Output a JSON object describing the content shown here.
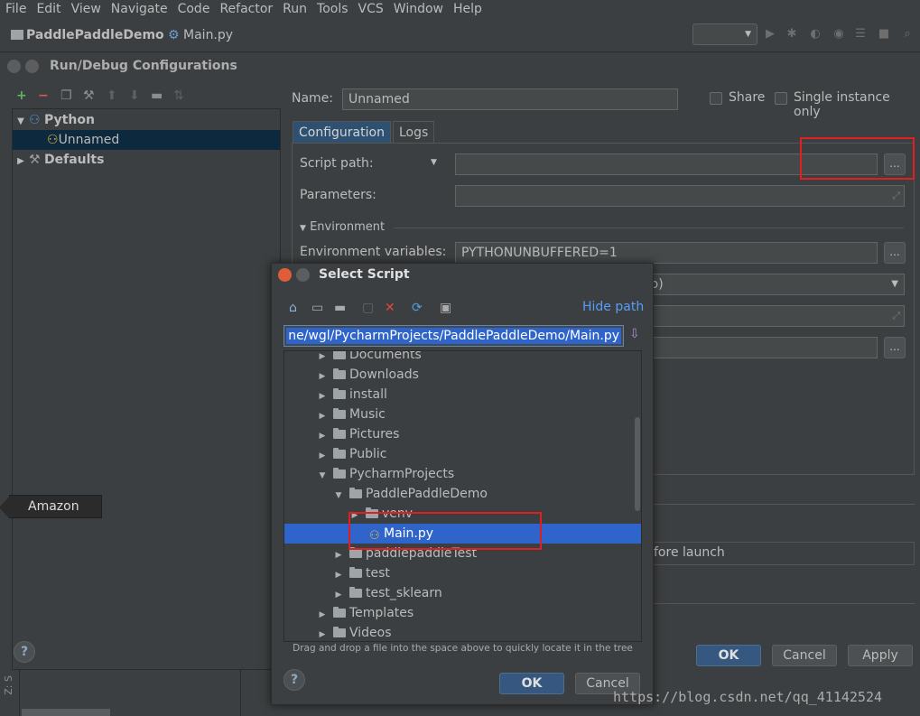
{
  "menu": [
    "File",
    "Edit",
    "View",
    "Navigate",
    "Code",
    "Refactor",
    "Run",
    "Tools",
    "VCS",
    "Window",
    "Help"
  ],
  "navbar": {
    "project": "PaddlePaddleDemo",
    "file": "Main.py"
  },
  "run_debug": {
    "title": "Run/Debug Configurations",
    "tree": {
      "python": "Python",
      "unnamed": "Unnamed",
      "defaults": "Defaults"
    },
    "name_label": "Name:",
    "name_value": "Unnamed",
    "share_label": "Share",
    "single_instance_label": "Single instance only",
    "tabs": {
      "configuration": "Configuration",
      "logs": "Logs"
    },
    "script_path_label": "Script path:",
    "script_path_value": "",
    "parameters_label": "Parameters:",
    "environment_section": "Environment",
    "env_vars_label": "Environment variables:",
    "env_vars_value": "PYTHONUNBUFFERED=1",
    "interpreter_partial": "mo)",
    "before_launch_partial": "fore launch",
    "ok": "OK",
    "cancel": "Cancel",
    "apply": "Apply",
    "dots": "..."
  },
  "amazon_tooltip": "Amazon",
  "select_script": {
    "title": "Select Script",
    "hide_path": "Hide path",
    "path": "ne/wgl/PycharmProjects/PaddlePaddleDemo/Main.py",
    "tree": [
      {
        "label": "Documents",
        "depth": 0,
        "type": "folder",
        "expanded": false
      },
      {
        "label": "Downloads",
        "depth": 0,
        "type": "folder",
        "expanded": false
      },
      {
        "label": "install",
        "depth": 0,
        "type": "folder",
        "expanded": false
      },
      {
        "label": "Music",
        "depth": 0,
        "type": "folder",
        "expanded": false
      },
      {
        "label": "Pictures",
        "depth": 0,
        "type": "folder",
        "expanded": false
      },
      {
        "label": "Public",
        "depth": 0,
        "type": "folder",
        "expanded": false
      },
      {
        "label": "PycharmProjects",
        "depth": 0,
        "type": "folder",
        "expanded": true
      },
      {
        "label": "PaddlePaddleDemo",
        "depth": 1,
        "type": "folder",
        "expanded": true
      },
      {
        "label": "venv",
        "depth": 2,
        "type": "folder",
        "expanded": false
      },
      {
        "label": "Main.py",
        "depth": 2,
        "type": "python-file",
        "selected": true
      },
      {
        "label": "paddlepaddleTest",
        "depth": 1,
        "type": "folder",
        "expanded": false
      },
      {
        "label": "test",
        "depth": 1,
        "type": "folder",
        "expanded": false
      },
      {
        "label": "test_sklearn",
        "depth": 1,
        "type": "folder",
        "expanded": false
      },
      {
        "label": "Templates",
        "depth": 0,
        "type": "folder",
        "expanded": false
      },
      {
        "label": "Videos",
        "depth": 0,
        "type": "folder",
        "expanded": false
      }
    ],
    "hint": "Drag and drop a file into the space above to quickly locate it in the tree",
    "ok": "OK",
    "cancel": "Cancel"
  },
  "side_label": "Z: S",
  "watermark": "https://blog.csdn.net/qq_41142524",
  "colors": {
    "background": "#3c3f41",
    "selection": "#2f65ca",
    "primary_button": "#365880",
    "highlight_box": "#e02020"
  }
}
